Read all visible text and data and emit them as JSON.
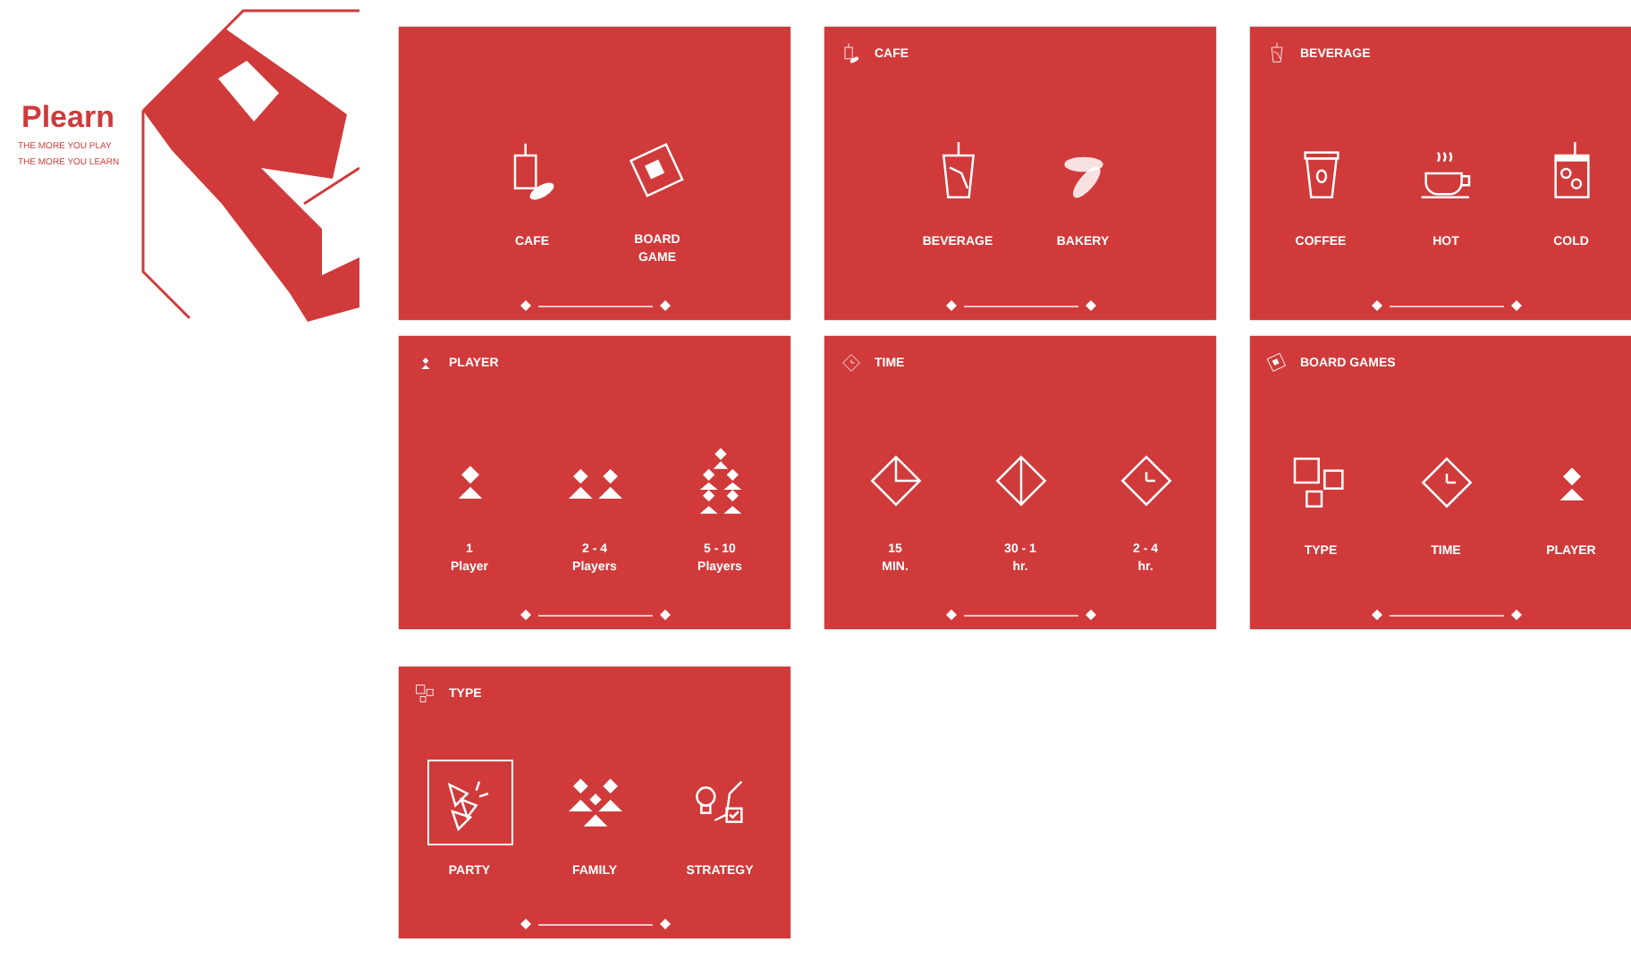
{
  "brand": {
    "name": "Plearn",
    "taglines": [
      "THE MORE YOU PLAY",
      "THE MORE YOU LEARN"
    ]
  },
  "screens": [
    {
      "options": [
        {
          "label": "CAFE",
          "selected": false
        },
        {
          "label": "BOARD\nGAME",
          "selected": false
        }
      ]
    },
    {
      "title": "CAFE",
      "options": [
        {
          "label": "BEVERAGE",
          "selected": false
        },
        {
          "label": "BAKERY",
          "selected": false
        }
      ]
    },
    {
      "title": "BEVERAGE",
      "options": [
        {
          "label": "COFFEE",
          "selected": false
        },
        {
          "label": "HOT",
          "selected": false
        },
        {
          "label": "COLD",
          "selected": false
        }
      ]
    },
    {
      "title": "PLAYER",
      "options": [
        {
          "label": "1\nPlayer",
          "selected": false
        },
        {
          "label": "2 - 4\nPlayers",
          "selected": false
        },
        {
          "label": "5 - 10\nPlayers",
          "selected": false
        }
      ]
    },
    {
      "title": "TIME",
      "options": [
        {
          "label": "15\nMIN.",
          "selected": false
        },
        {
          "label": "30 - 1\nhr.",
          "selected": false
        },
        {
          "label": "2 - 4\nhr.",
          "selected": false
        }
      ]
    },
    {
      "title": "BOARD GAMES",
      "options": [
        {
          "label": "TYPE",
          "selected": false
        },
        {
          "label": "TIME",
          "selected": false
        },
        {
          "label": "PLAYER",
          "selected": false
        }
      ]
    },
    {
      "title": "TYPE",
      "options": [
        {
          "label": "PARTY",
          "selected": true
        },
        {
          "label": "FAMILY",
          "selected": false
        },
        {
          "label": "STRATEGY",
          "selected": false
        }
      ]
    }
  ]
}
